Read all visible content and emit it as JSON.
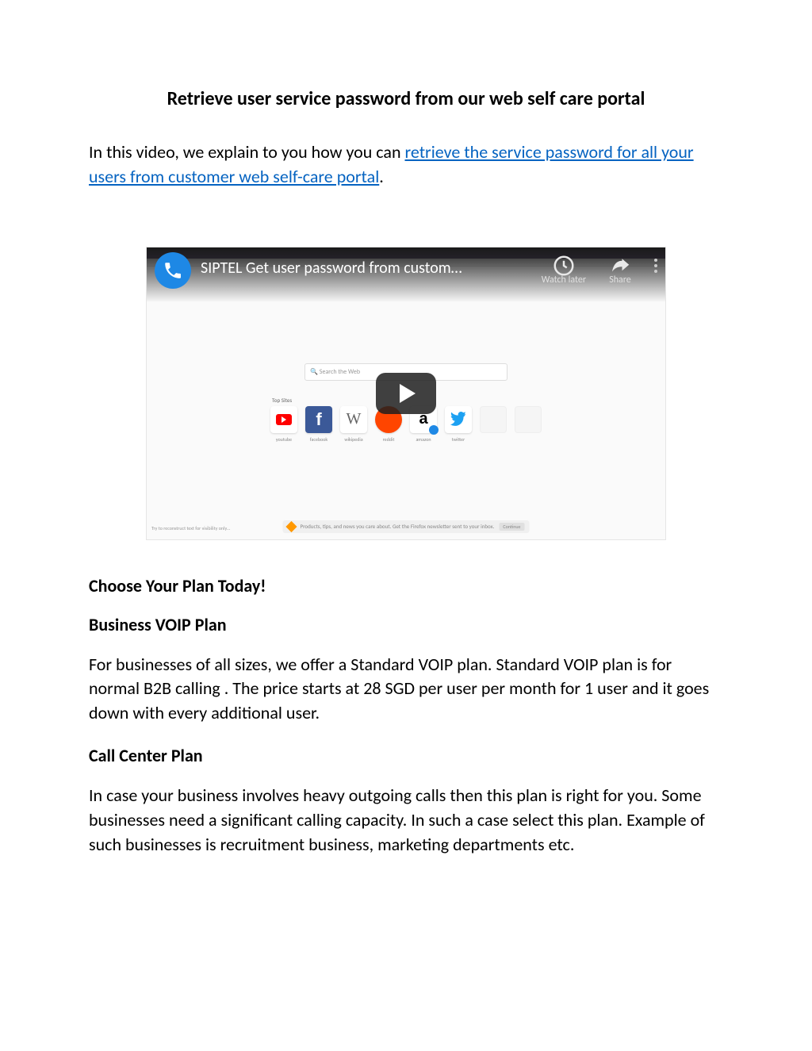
{
  "title": "Retrieve user service password from our web self care portal",
  "intro": {
    "lead": "In this video, we explain to you how you can ",
    "link_text": "retrieve the service password for all your users from customer web self-care portal",
    "trail": "."
  },
  "video": {
    "channel_icon": "phone-icon",
    "title": "SIPTEL Get user password from custom…",
    "watch_later": "Watch later",
    "share": "Share",
    "search_placeholder": "Search the Web",
    "top_sites_label": "Top Sites",
    "sites": [
      {
        "name": "youtube",
        "label": "youtube"
      },
      {
        "name": "facebook",
        "label": "facebook"
      },
      {
        "name": "wikipedia",
        "label": "wikipedia"
      },
      {
        "name": "reddit",
        "label": "reddit"
      },
      {
        "name": "amazon",
        "label": "amazon"
      },
      {
        "name": "twitter",
        "label": "twitter"
      }
    ],
    "footer_text": "Products, tips, and news you care about. Get the Firefox newsletter sent to your inbox.",
    "footer_btn": "Continue"
  },
  "sections": {
    "choose": "Choose Your Plan Today!",
    "voip_h": "Business VOIP Plan",
    "voip_p": "For businesses of all sizes, we offer a Standard VOIP plan. Standard VOIP plan is for normal B2B calling . The price starts at 28 SGD per user per month for 1 user and it goes down with every additional user.",
    "cc_h": "Call Center Plan",
    "cc_p": "In case your business involves heavy outgoing calls then this plan is right for you. Some businesses need a significant calling capacity. In such a case select this plan. Example of such businesses is recruitment business, marketing departments etc."
  }
}
